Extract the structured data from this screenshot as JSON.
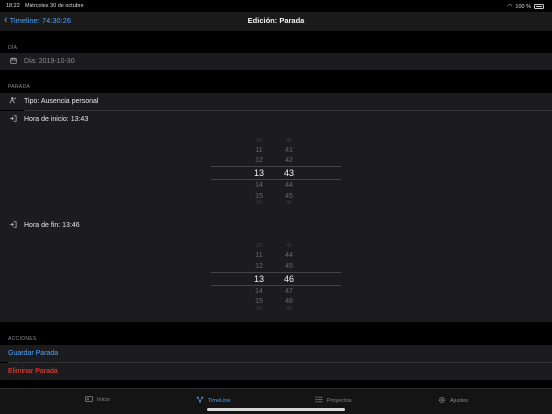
{
  "status": {
    "time": "18:22",
    "date": "Miércoles 30 de octubre",
    "battery": "100 %"
  },
  "nav": {
    "back_label": "Timeline: 74:30:26",
    "title": "Edición: Parada"
  },
  "dia": {
    "header": "DÍA",
    "value": "Día: 2019-10-30",
    "icon": "calendar-icon"
  },
  "parada": {
    "header": "PARADA",
    "tipo": "Tipo: Ausencia personal",
    "inicio": "Hora de inicio: 13:43",
    "fin": "Hora de fin: 13:46"
  },
  "picker_start": {
    "hours": [
      "10",
      "11",
      "12",
      "13",
      "14",
      "15",
      "16"
    ],
    "minutes": [
      "40",
      "41",
      "42",
      "43",
      "44",
      "45",
      "46"
    ],
    "selected_index": 3
  },
  "picker_end": {
    "hours": [
      "10",
      "11",
      "12",
      "13",
      "14",
      "15",
      "16"
    ],
    "minutes": [
      "43",
      "44",
      "45",
      "46",
      "47",
      "48",
      "49"
    ],
    "selected_index": 3
  },
  "acciones": {
    "header": "ACCIONES",
    "save": "Guardar Parada",
    "delete": "Eliminar Parada"
  },
  "tabs": [
    {
      "label": "Inicio",
      "icon": "home-icon",
      "active": false
    },
    {
      "label": "TimeLine",
      "icon": "timeline-icon",
      "active": true
    },
    {
      "label": "Proyectos",
      "icon": "list-icon",
      "active": false
    },
    {
      "label": "Ajustes",
      "icon": "gear-icon",
      "active": false
    }
  ],
  "colors": {
    "accent": "#4da3ff",
    "destructive": "#ff453a",
    "background": "#000000",
    "cell": "#1c1c1e"
  }
}
